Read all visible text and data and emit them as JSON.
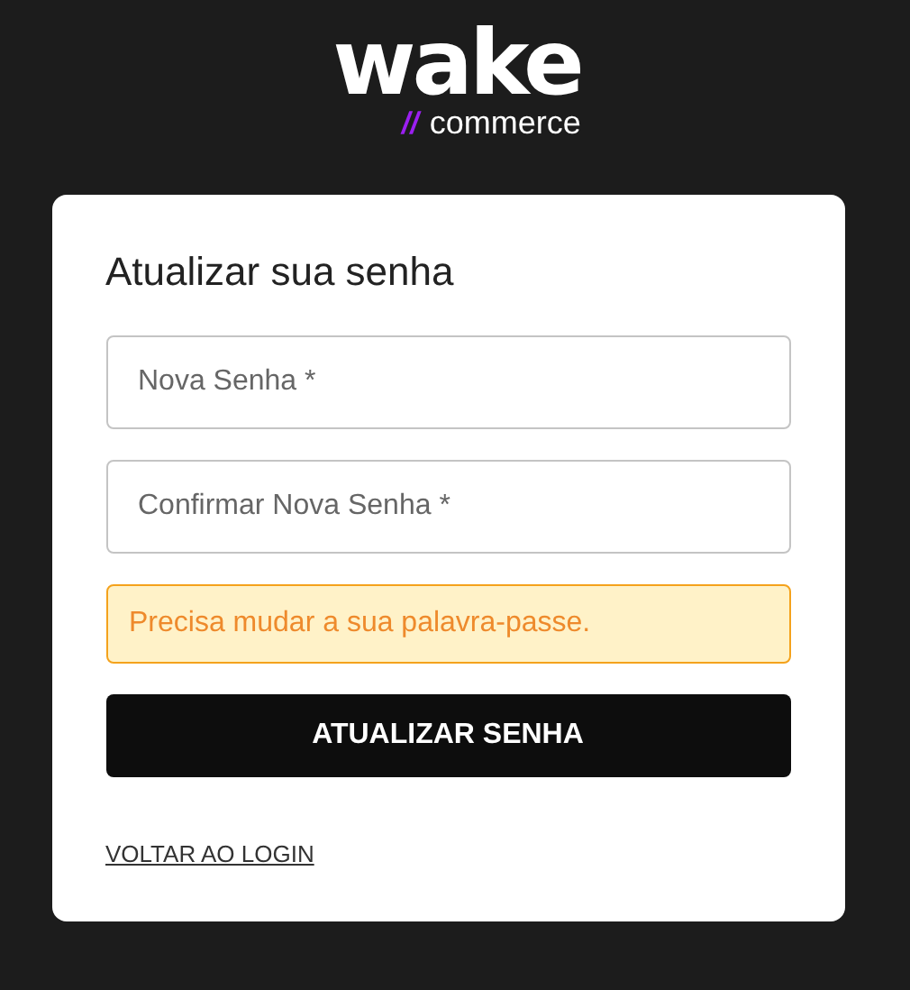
{
  "logo": {
    "word": "wake",
    "mark": "//",
    "sub": "commerce"
  },
  "card": {
    "title": "Atualizar sua senha",
    "fields": [
      {
        "placeholder": "Nova Senha *"
      },
      {
        "placeholder": "Confirmar Nova Senha *"
      }
    ],
    "alert": {
      "kind": "warning",
      "text": "Precisa mudar a sua palavra-passe."
    },
    "button": "ATUALIZAR SENHA",
    "link": "VOLTAR AO LOGIN"
  }
}
